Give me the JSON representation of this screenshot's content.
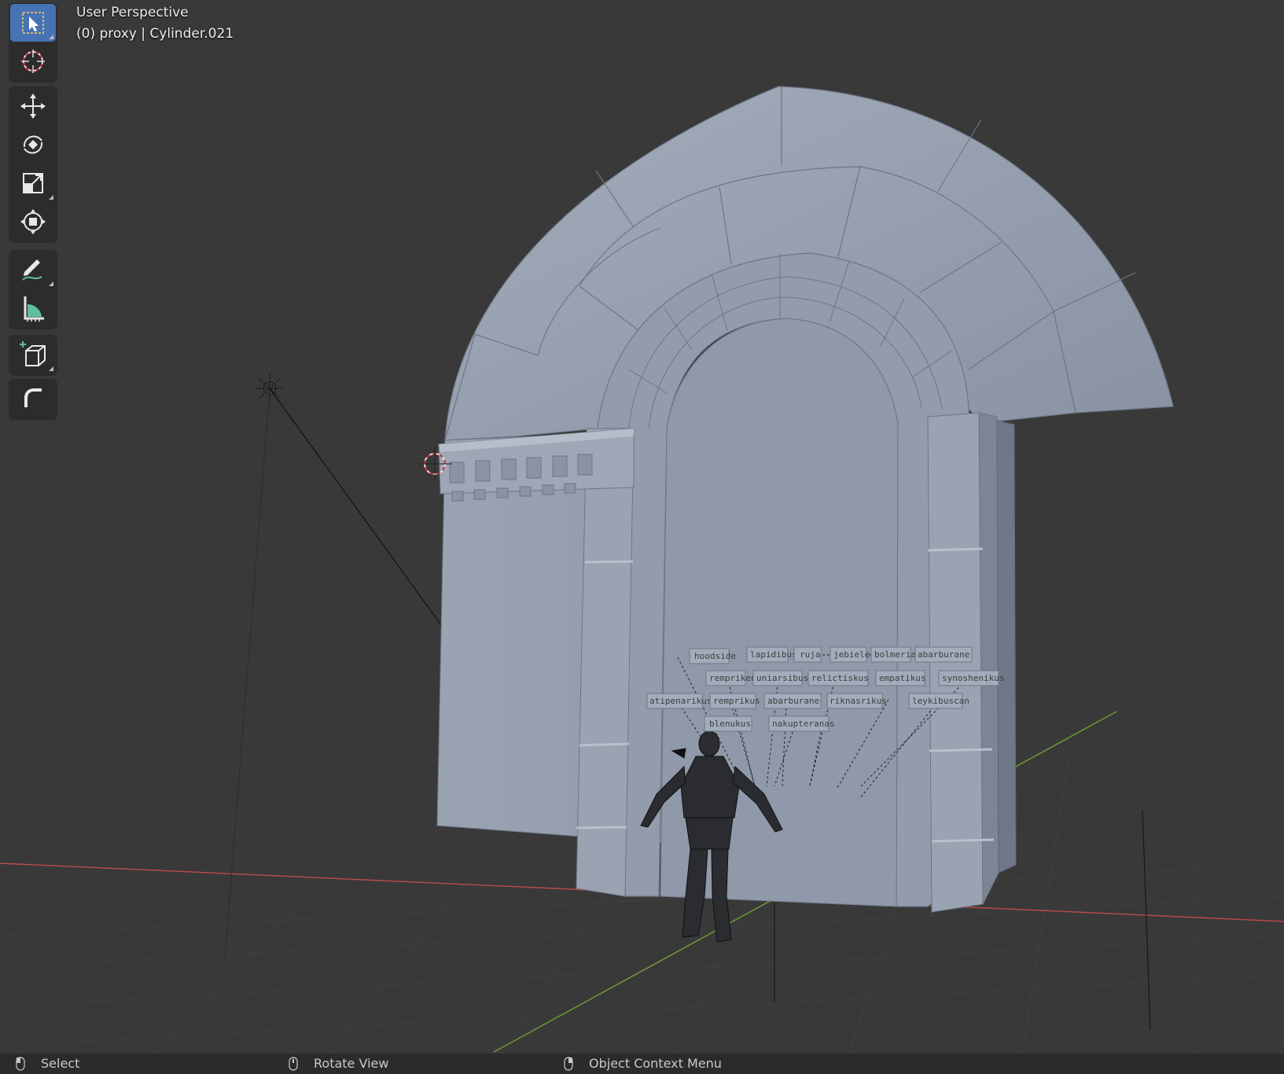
{
  "viewport": {
    "view_name": "User Perspective",
    "object_info": "(0) proxy | Cylinder.021"
  },
  "toolbar": {
    "groups": [
      [
        {
          "name": "select-box",
          "icon": "select-box-icon",
          "active": true
        },
        {
          "name": "cursor",
          "icon": "cursor-icon",
          "active": false
        }
      ],
      [
        {
          "name": "move",
          "icon": "move-icon",
          "active": false
        },
        {
          "name": "rotate",
          "icon": "rotate-icon",
          "active": false
        },
        {
          "name": "scale",
          "icon": "scale-icon",
          "active": false
        },
        {
          "name": "transform",
          "icon": "transform-icon",
          "active": false
        }
      ],
      [
        {
          "name": "annotate",
          "icon": "annotate-icon",
          "active": false
        },
        {
          "name": "measure",
          "icon": "measure-icon",
          "active": false
        }
      ],
      [
        {
          "name": "add-cube",
          "icon": "add-cube-icon",
          "active": false
        }
      ],
      [
        {
          "name": "bevel",
          "icon": "bevel-icon",
          "active": false
        }
      ]
    ]
  },
  "labels": {
    "row1": [
      "hoodside",
      "lapidibus",
      "ruja",
      "jebiele",
      "bolmeria",
      "abarburane"
    ],
    "row2": [
      "rempriken",
      "uniarsibus",
      "relictiskus",
      "empatikus",
      "synoshenikus"
    ],
    "row3": [
      "atipenarikus",
      "remprikus",
      "abarburane",
      "riknasrikus",
      "leykibuscan"
    ],
    "row4": [
      "blenukus",
      "nakupteranas"
    ]
  },
  "statusbar": {
    "select": "Select",
    "rotate": "Rotate View",
    "context": "Object Context Menu"
  },
  "colors": {
    "viewport_bg": "#393939",
    "active_tool": "#4772b3",
    "axis_x": "#b54a4a",
    "axis_y": "#6f9a35",
    "stone": "#8e98a8"
  }
}
